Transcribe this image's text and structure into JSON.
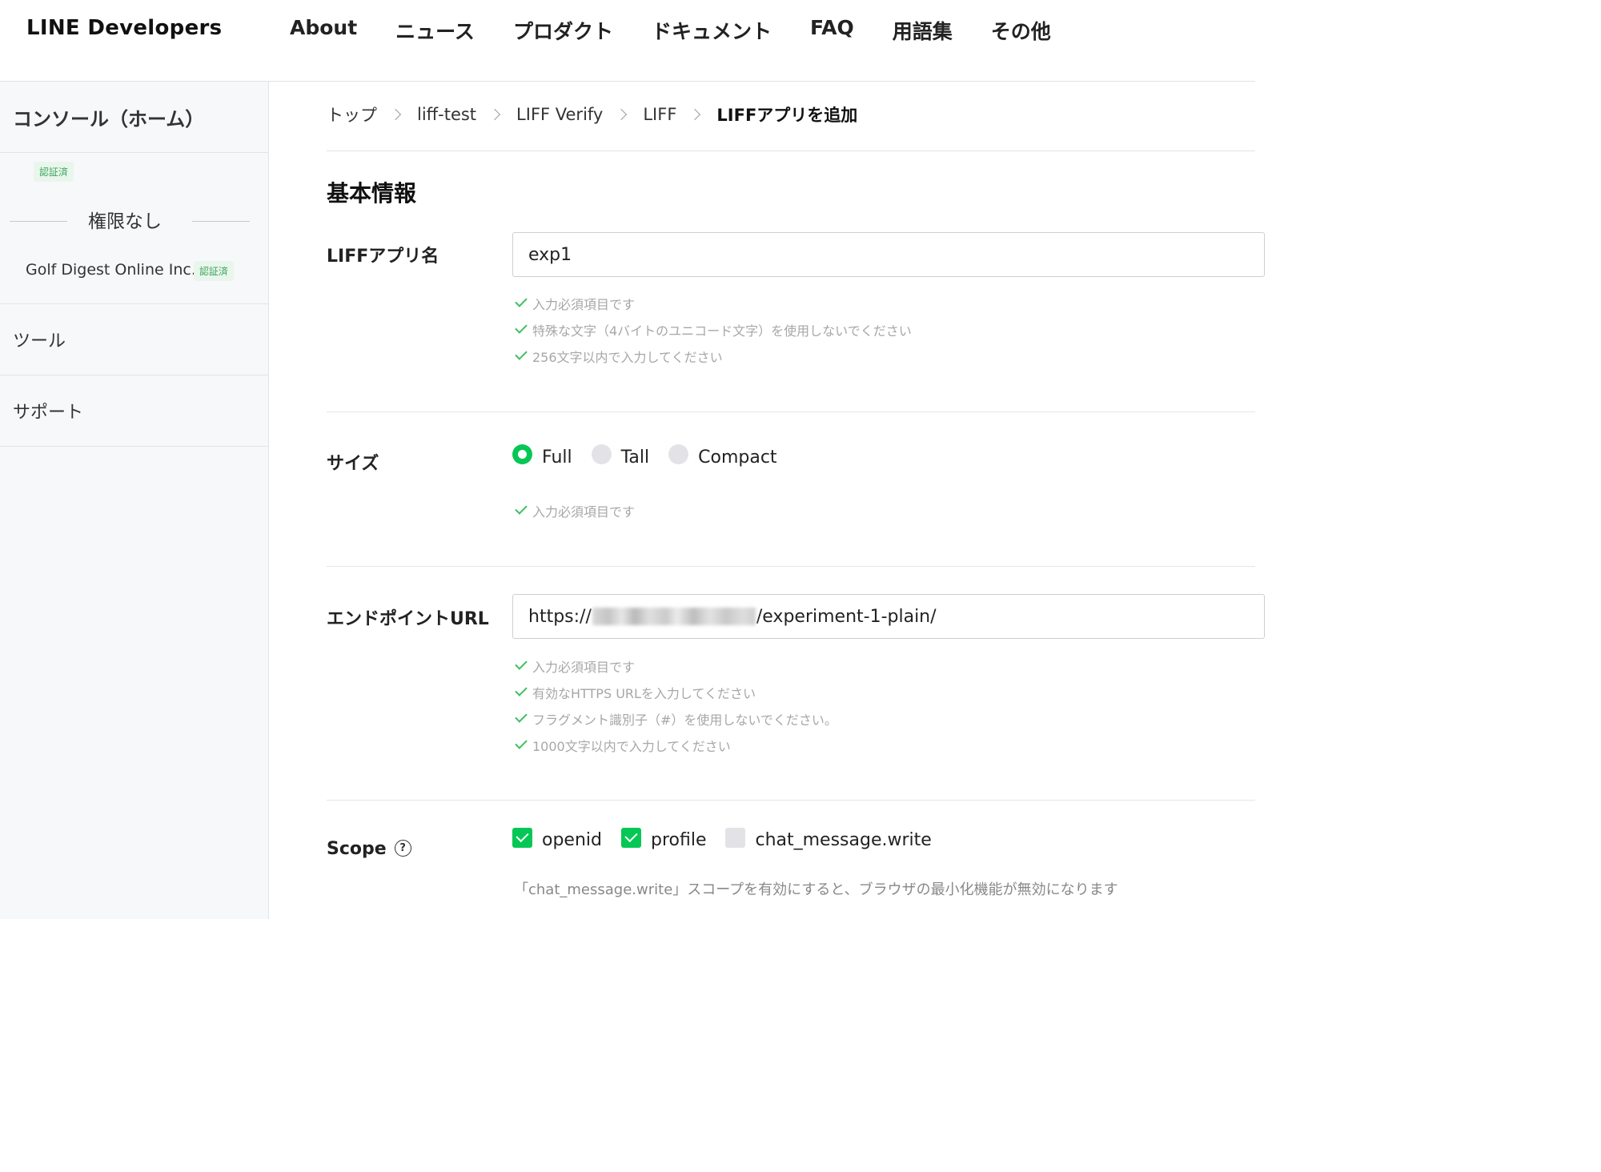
{
  "header": {
    "logo": "LINE Developers",
    "nav": [
      "About",
      "ニュース",
      "プロダクト",
      "ドキュメント",
      "FAQ",
      "用語集",
      "その他"
    ]
  },
  "sidebar": {
    "home": "コンソール（ホーム）",
    "verified_badge": "認証済",
    "permission_label": "権限なし",
    "company": "Golf Digest Online Inc.",
    "company_badge": "認証済",
    "tools": "ツール",
    "support": "サポート"
  },
  "breadcrumb": [
    "トップ",
    "liff-test",
    "LIFF Verify",
    "LIFF",
    "LIFFアプリを追加"
  ],
  "section_title": "基本情報",
  "app_name": {
    "label": "LIFFアプリ名",
    "value": "exp1",
    "hints": [
      "入力必須項目です",
      "特殊な文字（4バイトのユニコード文字）を使用しないでください",
      "256文字以内で入力してください"
    ]
  },
  "size": {
    "label": "サイズ",
    "options": [
      "Full",
      "Tall",
      "Compact"
    ],
    "selected": "Full",
    "hints": [
      "入力必須項目です"
    ]
  },
  "endpoint": {
    "label": "エンドポイントURL",
    "value_prefix": "https://",
    "value_suffix": "/experiment-1-plain/",
    "hints": [
      "入力必須項目です",
      "有効なHTTPS URLを入力してください",
      "フラグメント識別子（#）を使用しないでください。",
      "1000文字以内で入力してください"
    ]
  },
  "scope": {
    "label": "Scope",
    "help": "?",
    "options": [
      {
        "label": "openid",
        "checked": true
      },
      {
        "label": "profile",
        "checked": true
      },
      {
        "label": "chat_message.write",
        "checked": false
      }
    ],
    "note": "「chat_message.write」スコープを有効にすると、ブラウザの最小化機能が無効になります"
  },
  "colors": {
    "accent": "#06c755",
    "hint_check": "#3fbf5f",
    "badge_bg": "#e9f6ec",
    "badge_text": "#3aa55a"
  }
}
